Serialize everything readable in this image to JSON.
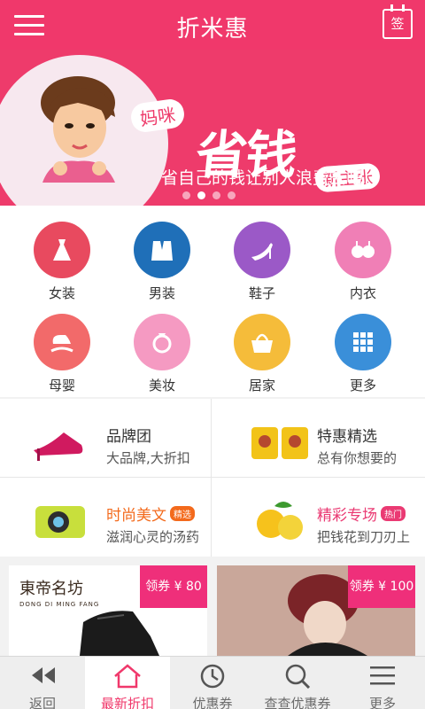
{
  "header": {
    "title": "折米惠",
    "sign_label": "签"
  },
  "banner": {
    "bubble": "妈咪",
    "headline": "省钱",
    "sub": "新主张",
    "tagline": "省自己的钱让别人浪费去吧!",
    "slide_count": 4,
    "active_slide": 2
  },
  "categories": [
    {
      "label": "女装",
      "color": "#e84a5f",
      "icon": "dress-icon"
    },
    {
      "label": "男装",
      "color": "#1f6fb8",
      "icon": "suit-icon"
    },
    {
      "label": "鞋子",
      "color": "#9b59c7",
      "icon": "heel-icon"
    },
    {
      "label": "内衣",
      "color": "#f07fb6",
      "icon": "bra-icon"
    },
    {
      "label": "母婴",
      "color": "#f26a6a",
      "icon": "rocking-horse-icon"
    },
    {
      "label": "美妆",
      "color": "#f59ac2",
      "icon": "ring-icon"
    },
    {
      "label": "居家",
      "color": "#f5bc3a",
      "icon": "basket-icon"
    },
    {
      "label": "更多",
      "color": "#3a8fd9",
      "icon": "grid-icon"
    }
  ],
  "promos": [
    {
      "title": "品牌团",
      "desc": "大品牌,大折扣",
      "tag": "",
      "style": ""
    },
    {
      "title": "特惠精选",
      "desc": "总有你想要的",
      "tag": "",
      "style": ""
    },
    {
      "title": "时尚美文",
      "desc": "滋润心灵的汤药",
      "tag": "精选",
      "style": "hl"
    },
    {
      "title": "精彩专场",
      "desc": "把钱花到刀刃上",
      "tag": "热门",
      "style": "pk"
    }
  ],
  "products": [
    {
      "coupon": "领券 ¥ 80",
      "brand": "東帝名坊",
      "brand_sub": "DONG DI MING FANG"
    },
    {
      "coupon": "领券 ¥ 100",
      "brand": "",
      "brand_sub": ""
    }
  ],
  "tabs": [
    {
      "label": "返回",
      "icon": "back-icon",
      "active": false
    },
    {
      "label": "最新折扣",
      "icon": "home-icon",
      "active": true
    },
    {
      "label": "优惠券",
      "icon": "clock-icon",
      "active": false
    },
    {
      "label": "查查优惠券",
      "icon": "search-icon",
      "active": false
    },
    {
      "label": "更多",
      "icon": "menu-icon",
      "active": false
    }
  ]
}
